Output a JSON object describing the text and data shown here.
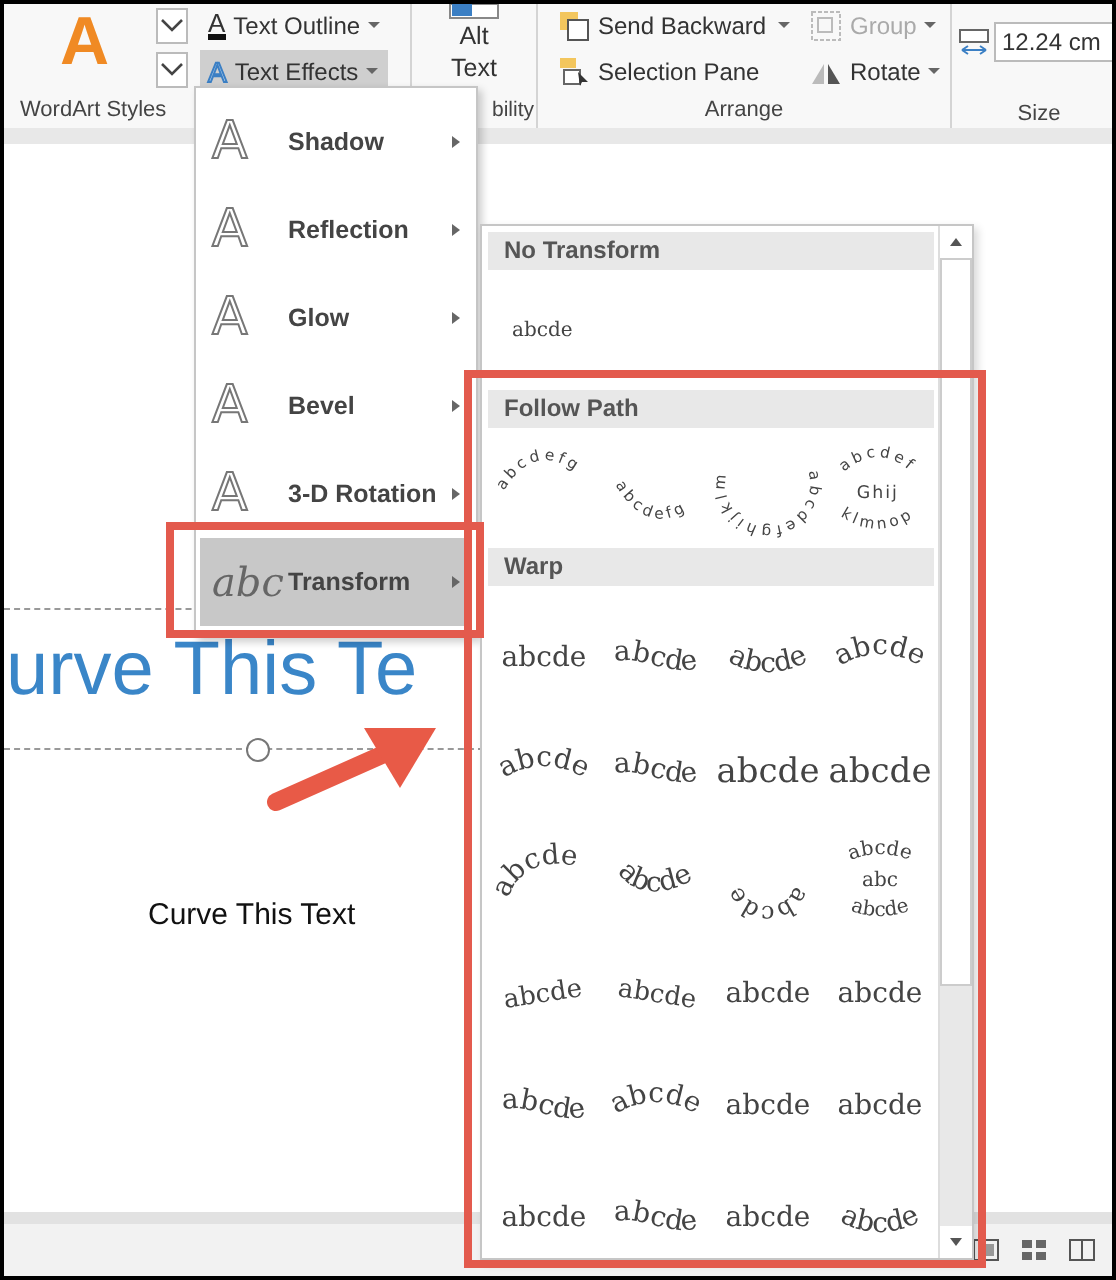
{
  "ribbon": {
    "wordart_glyph": "A",
    "text_outline": {
      "glyph": "A",
      "label": "Text Outline"
    },
    "text_effects": {
      "glyph": "A",
      "label": "Text Effects",
      "selected": true
    },
    "alt_text": "Alt Text",
    "send_backward": "Send Backward",
    "group": {
      "label": "Group",
      "disabled": true
    },
    "selection_pane": "Selection Pane",
    "rotate": "Rotate",
    "size_value": "12.24 cm",
    "group_labels": [
      "WordArt Styles",
      "bility",
      "Arrange",
      "Size"
    ]
  },
  "text_effects_menu": [
    {
      "glyph": "A",
      "label": "Shadow",
      "selected": false
    },
    {
      "glyph": "A",
      "label": "Reflection",
      "selected": false
    },
    {
      "glyph": "A",
      "label": "Glow",
      "selected": false
    },
    {
      "glyph": "A",
      "label": "Bevel",
      "selected": false
    },
    {
      "glyph": "A",
      "label": "3-D Rotation",
      "selected": false
    },
    {
      "glyph": "abc",
      "label": "Transform",
      "selected": true
    }
  ],
  "transform_gallery": {
    "no_transform": {
      "heading": "No Transform",
      "sample": "abcde"
    },
    "follow_path": {
      "heading": "Follow Path",
      "items": [
        {
          "kind": "arch-up",
          "text": "abcdefg"
        },
        {
          "kind": "arch-down",
          "text": "abcdefg"
        },
        {
          "kind": "circle",
          "text": "abcdefghijklm"
        },
        {
          "kind": "button",
          "text": "abcdef",
          "middle": "Ghij",
          "bottom": "klmnop"
        }
      ]
    },
    "warp": {
      "heading": "Warp",
      "items": [
        {
          "kind": "plain",
          "text": "abcde"
        },
        {
          "kind": "wave",
          "text": "abcde"
        },
        {
          "kind": "arch-down",
          "text": "abcde"
        },
        {
          "kind": "arch-up",
          "text": "abcde"
        },
        {
          "kind": "arch-up",
          "text": "abcde"
        },
        {
          "kind": "wave",
          "text": "abcde"
        },
        {
          "kind": "inflate",
          "text": "abcde"
        },
        {
          "kind": "inflate",
          "text": "abcde"
        },
        {
          "kind": "arc-big",
          "text": "abcde"
        },
        {
          "kind": "arc-down",
          "text": "abcde"
        },
        {
          "kind": "ring",
          "text": "abcde"
        },
        {
          "kind": "button",
          "text": "abcde",
          "middle": "abc",
          "bottom": "abcde"
        },
        {
          "kind": "tilt-up",
          "text": "abcde"
        },
        {
          "kind": "tilt-down",
          "text": "abcde"
        },
        {
          "kind": "plain",
          "text": "abcde"
        },
        {
          "kind": "plain",
          "text": "abcde"
        },
        {
          "kind": "wave",
          "text": "abcde"
        },
        {
          "kind": "arch-up",
          "text": "abcde"
        },
        {
          "kind": "plain",
          "text": "abcde"
        },
        {
          "kind": "plain",
          "text": "abcde"
        },
        {
          "kind": "plain",
          "text": "abcde"
        },
        {
          "kind": "wave",
          "text": "abcde"
        },
        {
          "kind": "plain",
          "text": "abcde"
        },
        {
          "kind": "arch-down",
          "text": "abcde"
        }
      ]
    }
  },
  "slide": {
    "title_text": "urve This Te",
    "body_text": "Curve This Text"
  }
}
